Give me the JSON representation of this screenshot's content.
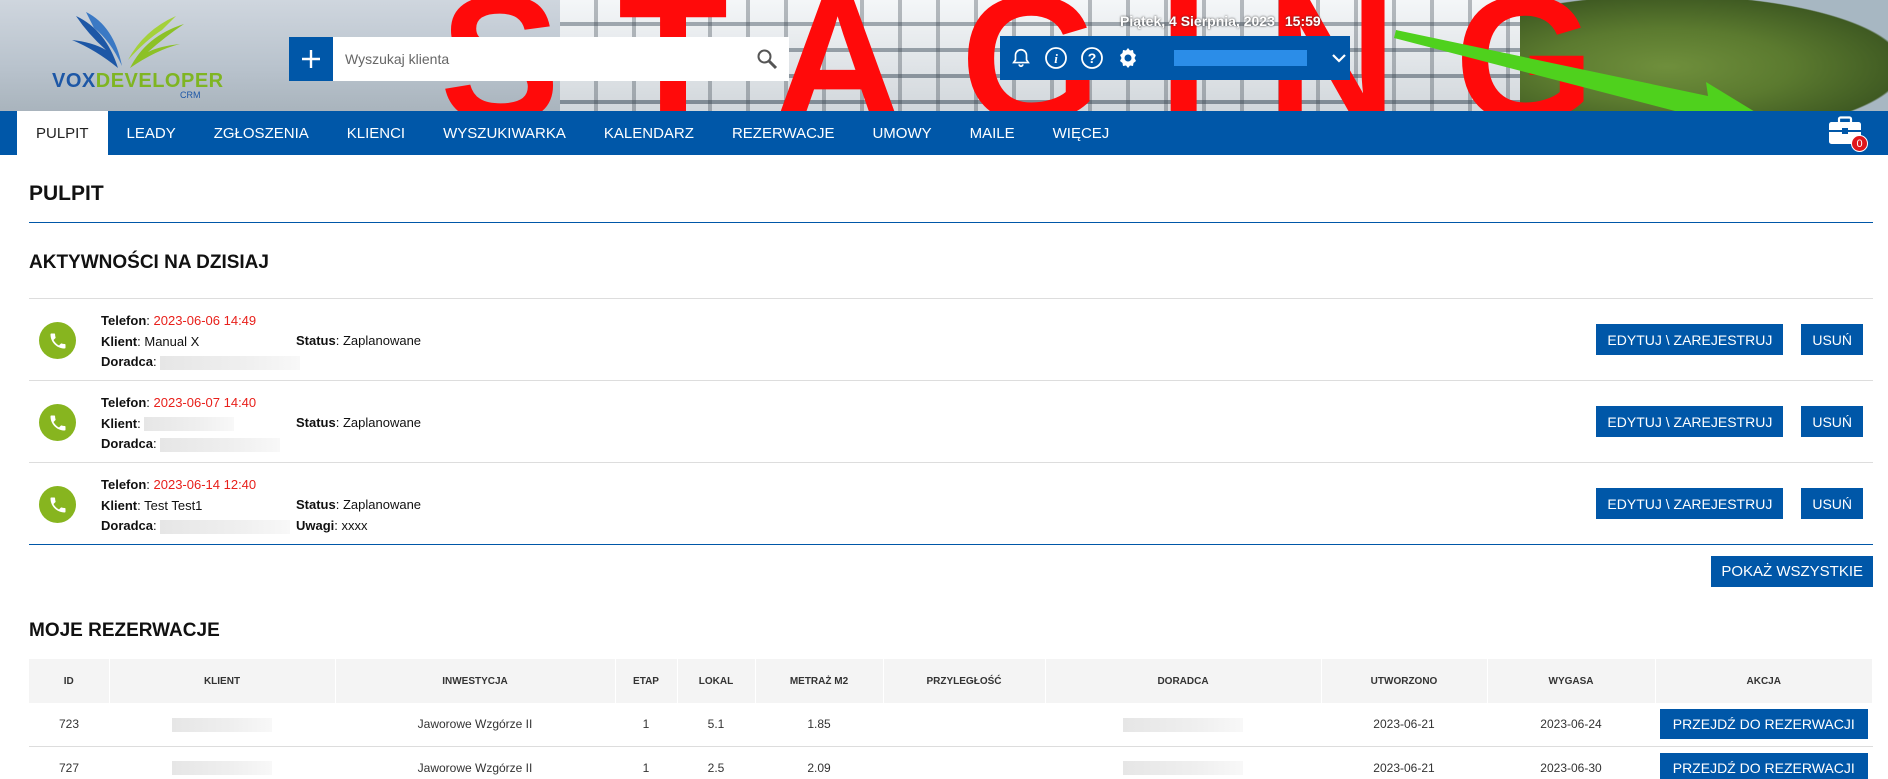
{
  "banner": {
    "watermark": "STAGING",
    "logo": {
      "brand_a": "VOX",
      "brand_b": "DEVELOPER",
      "sub": "CRM"
    },
    "datetime": {
      "date": "Piątek, 4 Sierpnia, 2023",
      "time": "15:59"
    }
  },
  "search": {
    "placeholder": "Wyszukaj klienta"
  },
  "nav": {
    "items": [
      "PULPIT",
      "LEADY",
      "ZGŁOSZENIA",
      "KLIENCI",
      "WYSZUKIWARKA",
      "KALENDARZ",
      "REZERWACJE",
      "UMOWY",
      "MAILE",
      "WIĘCEJ"
    ],
    "briefcase_count": "0"
  },
  "page": {
    "title": "PULPIT",
    "activities_title": "AKTYWNOŚCI NA DZISIAJ",
    "reservations_title": "MOJE REZERWACJE",
    "show_all": "POKAŻ WSZYSTKIE"
  },
  "labels": {
    "phone": "Telefon",
    "client": "Klient",
    "advisor": "Doradca",
    "status": "Status",
    "notes": "Uwagi",
    "edit": "EDYTUJ \\ ZAREJESTRUJ",
    "delete": "USUŃ",
    "go_to": "PRZEJDŹ DO REZERWACJI"
  },
  "activities": [
    {
      "datetime": "2023-06-06 14:49",
      "client": "Manual X",
      "status": "Zaplanowane",
      "notes": ""
    },
    {
      "datetime": "2023-06-07 14:40",
      "client": "",
      "status": "Zaplanowane",
      "notes": ""
    },
    {
      "datetime": "2023-06-14 12:40",
      "client": "Test Test1",
      "status": "Zaplanowane",
      "notes": "xxxx"
    }
  ],
  "reservations": {
    "columns": [
      "ID",
      "KLIENT",
      "INWESTYCJA",
      "ETAP",
      "LOKAL",
      "METRAŻ M2",
      "PRZYLEGŁOŚĆ",
      "DORADCA",
      "UTWORZONO",
      "WYGASA",
      "AKCJA"
    ],
    "rows": [
      {
        "id": "723",
        "investment": "Jaworowe Wzgórze II",
        "stage": "1",
        "unit": "5.1",
        "area": "1.85",
        "adjacency": "",
        "created": "2023-06-21",
        "expires": "2023-06-24"
      },
      {
        "id": "727",
        "investment": "Jaworowe Wzgórze II",
        "stage": "1",
        "unit": "2.5",
        "area": "2.09",
        "adjacency": "",
        "created": "2023-06-21",
        "expires": "2023-06-30"
      }
    ]
  },
  "colors": {
    "primary": "#0057a8",
    "accent_green": "#87b51f",
    "date_red": "#e8201b",
    "badge_red": "#e0161b"
  }
}
